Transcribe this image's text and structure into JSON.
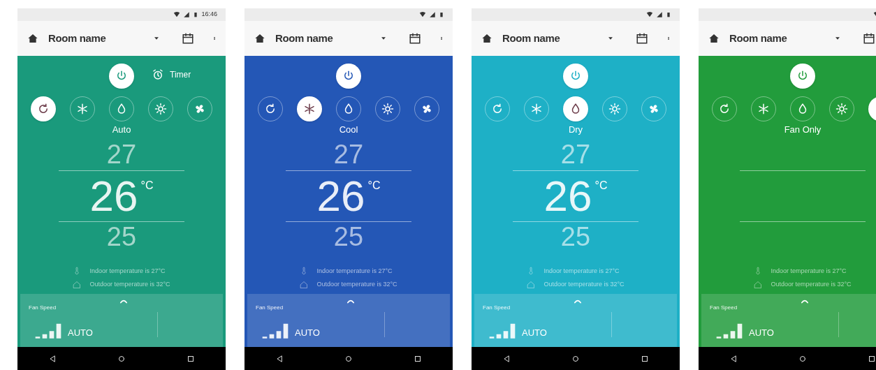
{
  "phones": [
    {
      "color": "#1a9a7c",
      "status_time": "16:46",
      "room": "Room name",
      "timer": {
        "label": "Timer"
      },
      "modes": [
        {
          "kind": "auto",
          "selected": true
        },
        {
          "kind": "cool",
          "selected": false
        },
        {
          "kind": "dry",
          "selected": false
        },
        {
          "kind": "heat",
          "selected": false
        },
        {
          "kind": "fan",
          "selected": false
        }
      ],
      "mode_label": "Auto",
      "temperature": {
        "above": "27",
        "current": "26",
        "unit": "°C",
        "below": "25"
      },
      "readings": [
        "Indoor temperature is 27°C",
        "Outdoor temperature is 32°C"
      ],
      "fan_speed": {
        "label": "Fan Speed",
        "value": "AUTO"
      }
    },
    {
      "color": "#2457b6",
      "room": "Room name",
      "modes": [
        {
          "kind": "auto",
          "selected": false
        },
        {
          "kind": "cool",
          "selected": true
        },
        {
          "kind": "dry",
          "selected": false
        },
        {
          "kind": "heat",
          "selected": false
        },
        {
          "kind": "fan",
          "selected": false
        }
      ],
      "mode_label": "Cool",
      "temperature": {
        "above": "27",
        "current": "26",
        "unit": "°C",
        "below": "25"
      },
      "readings": [
        "Indoor temperature is 27°C",
        "Outdoor temperature is 32°C"
      ],
      "fan_speed": {
        "label": "Fan Speed",
        "value": "AUTO"
      }
    },
    {
      "color": "#1eb0c6",
      "room": "Room name",
      "modes": [
        {
          "kind": "auto",
          "selected": false
        },
        {
          "kind": "cool",
          "selected": false
        },
        {
          "kind": "dry",
          "selected": true
        },
        {
          "kind": "heat",
          "selected": false
        },
        {
          "kind": "fan",
          "selected": false
        }
      ],
      "mode_label": "Dry",
      "temperature": {
        "above": "27",
        "current": "26",
        "unit": "°C",
        "below": "25"
      },
      "readings": [
        "Indoor temperature is 27°C",
        "Outdoor temperature is 32°C"
      ],
      "fan_speed": {
        "label": "Fan Speed",
        "value": "AUTO"
      }
    },
    {
      "color": "#229c3c",
      "room": "Room name",
      "modes": [
        {
          "kind": "auto",
          "selected": false
        },
        {
          "kind": "cool",
          "selected": false
        },
        {
          "kind": "dry",
          "selected": false
        },
        {
          "kind": "heat",
          "selected": false
        },
        {
          "kind": "fan",
          "selected": true
        }
      ],
      "mode_label": "Fan Only",
      "readings": [
        "Indoor temperature is 27°C",
        "Outdoor temperature is 32°C"
      ],
      "fan_speed": {
        "label": "Fan Speed",
        "value": "AUTO"
      }
    }
  ]
}
